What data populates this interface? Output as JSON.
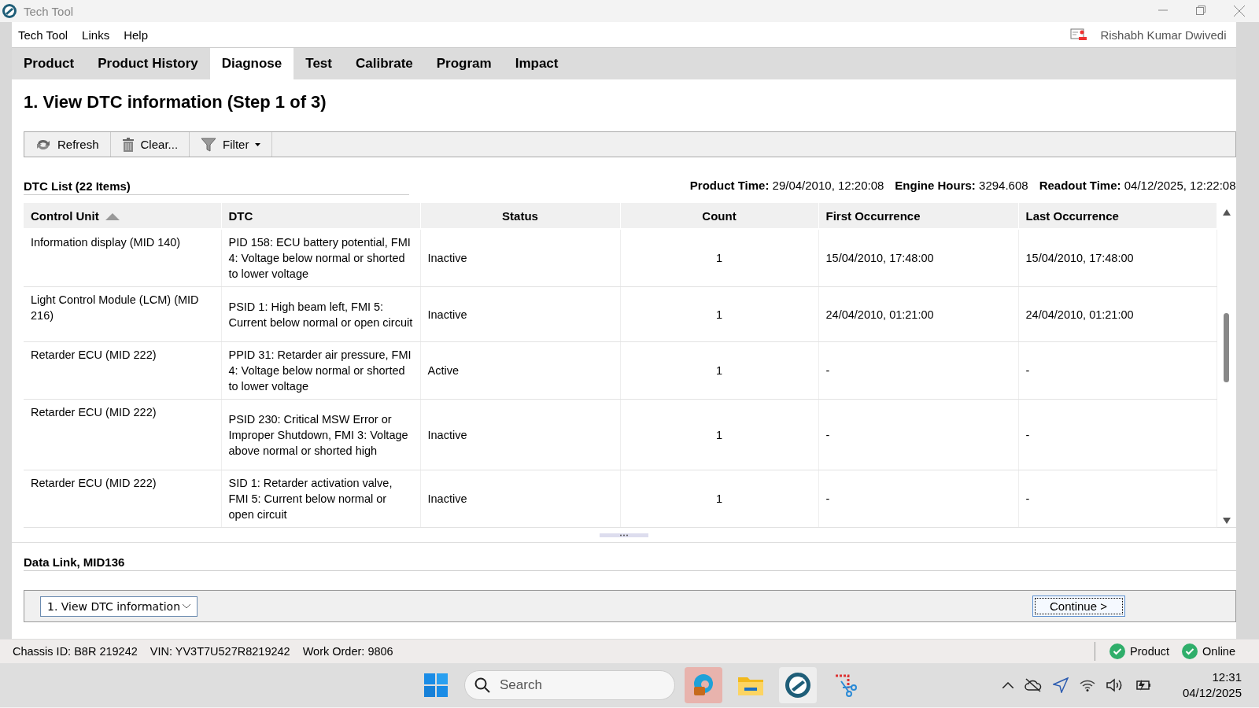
{
  "window": {
    "title": "Tech Tool"
  },
  "menu": [
    "Tech Tool",
    "Links",
    "Help"
  ],
  "user": "Rishabh Kumar Dwivedi",
  "tabs": [
    {
      "label": "Product",
      "selected": false
    },
    {
      "label": "Product History",
      "selected": false
    },
    {
      "label": "Diagnose",
      "selected": true
    },
    {
      "label": "Test",
      "selected": false
    },
    {
      "label": "Calibrate",
      "selected": false
    },
    {
      "label": "Program",
      "selected": false
    },
    {
      "label": "Impact",
      "selected": false
    }
  ],
  "page_title": "1. View DTC information (Step 1 of 3)",
  "toolbar": [
    {
      "kind": "refresh",
      "label": "Refresh"
    },
    {
      "kind": "clear",
      "label": "Clear..."
    },
    {
      "kind": "filter",
      "label": "Filter"
    }
  ],
  "list_title": "DTC List (22 Items)",
  "readouts": [
    {
      "label": "Product Time:",
      "value": "29/04/2010, 12:20:08"
    },
    {
      "label": "Engine Hours:",
      "value": "3294.608"
    },
    {
      "label": "Readout Time:",
      "value": "04/12/2025, 12:22:08"
    }
  ],
  "table": {
    "columns": [
      "Control Unit",
      "DTC",
      "Status",
      "Count",
      "First Occurrence",
      "Last Occurrence"
    ],
    "rows": [
      [
        "Information display (MID 140)",
        "PID 158: ECU battery potential, FMI 4: Voltage below normal or shorted to lower voltage",
        "Inactive",
        "1",
        "15/04/2010, 17:48:00",
        "15/04/2010, 17:48:00"
      ],
      [
        "Light Control Module (LCM) (MID 216)",
        "PSID 1: High beam left, FMI 5: Current below normal or open circuit",
        "Inactive",
        "1",
        "24/04/2010, 01:21:00",
        "24/04/2010, 01:21:00"
      ],
      [
        "Retarder ECU (MID 222)",
        "PPID 31: Retarder air pressure, FMI 4: Voltage below normal or shorted to lower voltage",
        "Active",
        "1",
        "-",
        "-"
      ],
      [
        "Retarder ECU (MID 222)",
        "PSID 230: Critical MSW Error or Improper Shutdown, FMI 3: Voltage above normal or shorted high",
        "Inactive",
        "1",
        "-",
        "-"
      ],
      [
        "Retarder ECU (MID 222)",
        "SID 1: Retarder activation valve, FMI 5: Current below normal or open circuit",
        "Inactive",
        "1",
        "-",
        "-"
      ]
    ]
  },
  "data_link_title": "Data Link, MID136",
  "step_select": "1. View DTC information",
  "continue_button": "Continue >",
  "status_bar": {
    "items": [
      "Chassis ID: B8R 219242",
      "VIN: YV3T7U527R8219242",
      "Work Order: 9806"
    ],
    "indicators": [
      "Product",
      "Online"
    ]
  },
  "taskbar": {
    "search_placeholder": "Search",
    "time": "12:31",
    "date": "04/12/2025"
  }
}
